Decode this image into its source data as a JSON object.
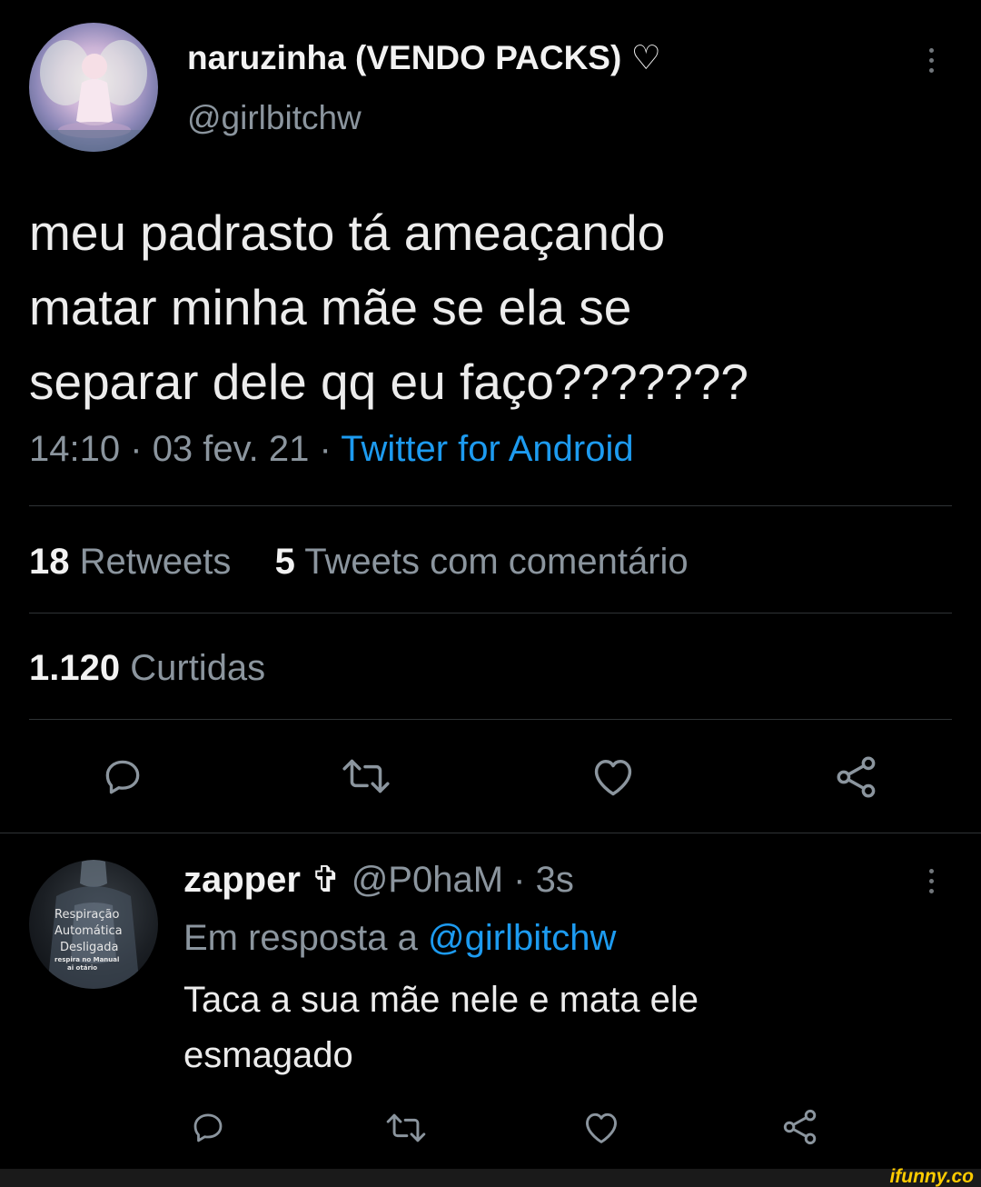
{
  "tweet": {
    "display_name": "naruzinha (VENDO PACKS) ♡",
    "handle": "@girlbitchw",
    "text_lines": [
      "meu padrasto tá ameaçando",
      "matar minha mãe se ela se",
      "separar dele qq eu faço???????"
    ],
    "time": "14:10",
    "date": "03 fev. 21",
    "source": "Twitter for Android",
    "separator": "·",
    "retweets_count": "18",
    "retweets_label": "Retweets",
    "quotes_count": "5",
    "quotes_label": "Tweets com comentário",
    "likes_count": "1.120",
    "likes_label": "Curtidas",
    "actions": [
      "reply-icon",
      "retweet-icon",
      "like-icon",
      "share-icon"
    ]
  },
  "reply": {
    "display_name": "zapper",
    "badge": "✞",
    "handle": "@P0haM",
    "age": "3s",
    "separator": "·",
    "reply_prefix": "Em resposta a",
    "reply_to": "@girlbitchw",
    "text_lines": [
      "Taca a sua mãe nele e mata ele",
      "esmagado"
    ],
    "avatar_text": [
      "Respiração",
      "Automática",
      "Desligada",
      "respira no Manual",
      "ai otário"
    ],
    "actions": [
      "reply-icon",
      "retweet-icon",
      "like-icon",
      "share-icon"
    ]
  },
  "watermark": "ifunny.co",
  "colors": {
    "background": "#000000",
    "text": "#e7e9ea",
    "muted": "#8b959e",
    "link": "#1d9bf0",
    "divider": "#2f3336",
    "watermark_bar": "#1a1a1a",
    "watermark_text": "#ffcc00"
  }
}
